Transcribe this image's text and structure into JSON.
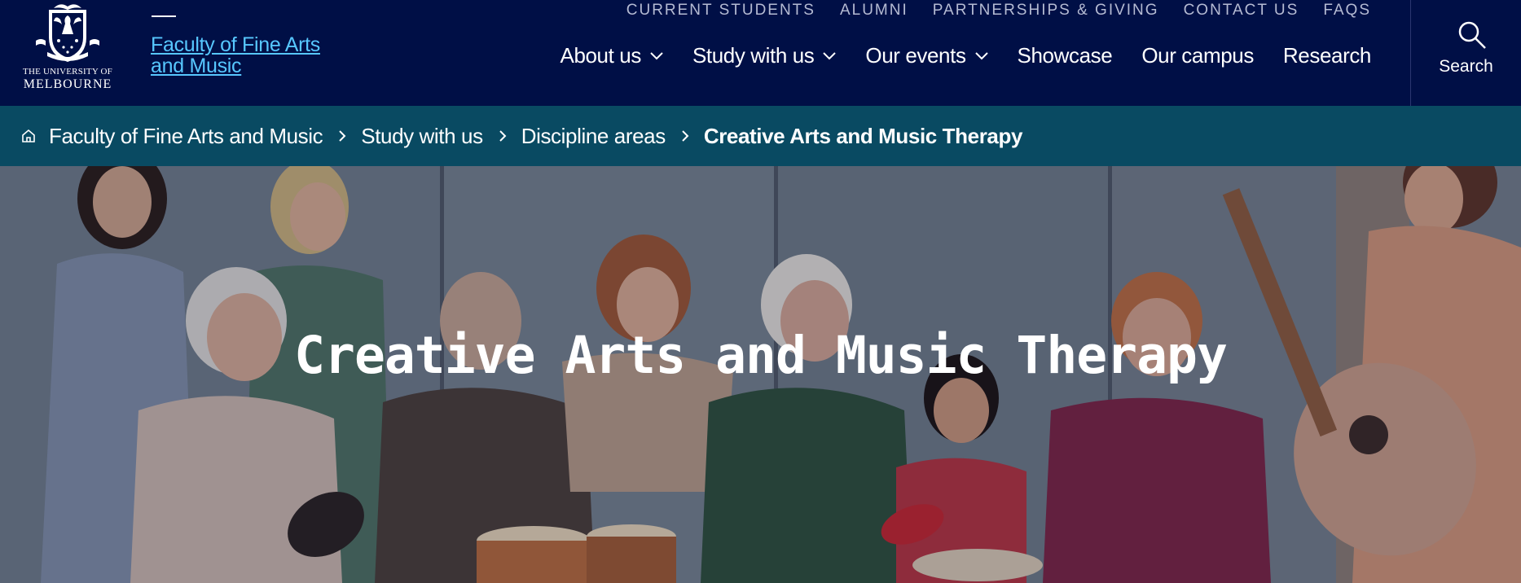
{
  "brand": {
    "university_line1": "THE UNIVERSITY OF",
    "university_line2": "MELBOURNE",
    "faculty_title": "Faculty of Fine Arts and Music"
  },
  "utility_nav": [
    "CURRENT STUDENTS",
    "ALUMNI",
    "PARTNERSHIPS & GIVING",
    "CONTACT US",
    "FAQS"
  ],
  "main_nav": [
    {
      "label": "About us",
      "icon": "chevron-down-icon"
    },
    {
      "label": "Study with us",
      "icon": "chevron-down-icon"
    },
    {
      "label": "Our events",
      "icon": "chevron-down-icon"
    },
    {
      "label": "Showcase"
    },
    {
      "label": "Our campus"
    },
    {
      "label": "Research"
    }
  ],
  "search": {
    "label": "Search",
    "icon": "search-icon"
  },
  "breadcrumb": {
    "icon": "home-icon",
    "items": [
      "Faculty of Fine Arts and Music",
      "Study with us",
      "Discipline areas"
    ],
    "current": "Creative Arts and Music Therapy",
    "separator_icon": "chevron-right-icon"
  },
  "hero": {
    "title": "Creative Arts and Music Therapy",
    "image": "group-music-therapy-photo"
  },
  "colors": {
    "header_bg": "#000f46",
    "breadcrumb_bg": "#094a62",
    "faculty_link": "#57c7ff",
    "utility_text": "#b5bbd3"
  }
}
